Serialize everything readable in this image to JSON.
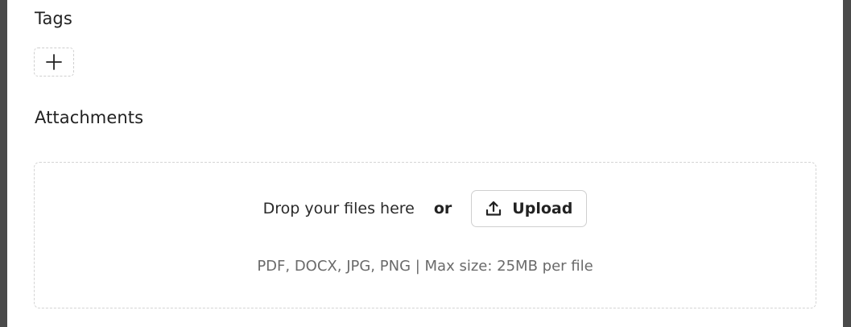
{
  "tags": {
    "title": "Tags",
    "add_icon": "plus-icon"
  },
  "attachments": {
    "title": "Attachments",
    "drop_text": "Drop your files here",
    "or_text": "or",
    "upload_label": "Upload",
    "upload_icon": "upload-icon",
    "hint": "PDF, DOCX, JPG, PNG | Max size: 25MB per file"
  },
  "colors": {
    "background": "#ffffff",
    "frame": "#4a4a4a",
    "border": "#cfcfcf",
    "muted_text": "#6a6a6a"
  }
}
